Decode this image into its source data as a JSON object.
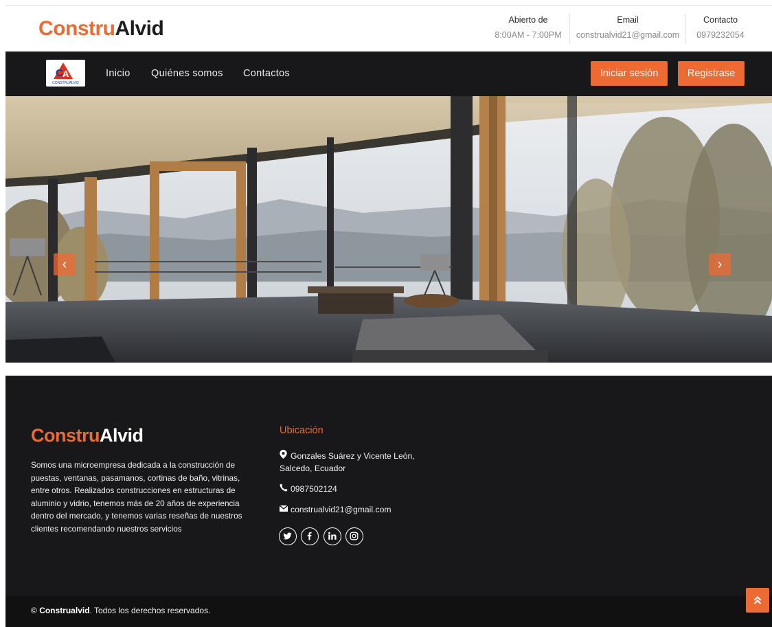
{
  "brand": {
    "part1": "Constru",
    "part2": "Alvid"
  },
  "top_info": [
    {
      "label": "Abierto de",
      "value": "8:00AM - 7:00PM"
    },
    {
      "label": "Email",
      "value": "construalvid21@gmail.com"
    },
    {
      "label": "Contacto",
      "value": "0979232054"
    }
  ],
  "nav": {
    "logo_text": "CONSTRUALVID",
    "links": [
      "Inicio",
      "Quiénes somos",
      "Contactos"
    ],
    "login_label": "Iniciar sesión",
    "register_label": "Registrase"
  },
  "carousel": {
    "prev_icon": "‹",
    "next_icon": "›"
  },
  "footer": {
    "about": "Somos una microempresa dedicada a la construcción de puestas, ventanas, pasamanos, cortinas de baño, vitrinas, entre otros. Realizados construcciones en estructuras de aluminio y vidrio, tenemos más de 20 años de experiencia dentro del mercado, y tenemos varias reseñas de nuestros clientes recomendando nuestros servicios",
    "location_title": "Ubicación",
    "address_line1": "Gonzales Suárez y Vicente León,",
    "address_line2": "Salcedo, Ecuador",
    "phone": "0987502124",
    "email": "construalvid21@gmail.com",
    "socials": [
      "twitter-icon",
      "facebook-icon",
      "linkedin-icon",
      "instagram-icon"
    ],
    "copyright_symbol": "©",
    "copyright_brand": "Construalvid",
    "copyright_rest": ". Todos los derechos reservados."
  },
  "colors": {
    "accent": "#ee6a33",
    "dark": "#18181a"
  }
}
